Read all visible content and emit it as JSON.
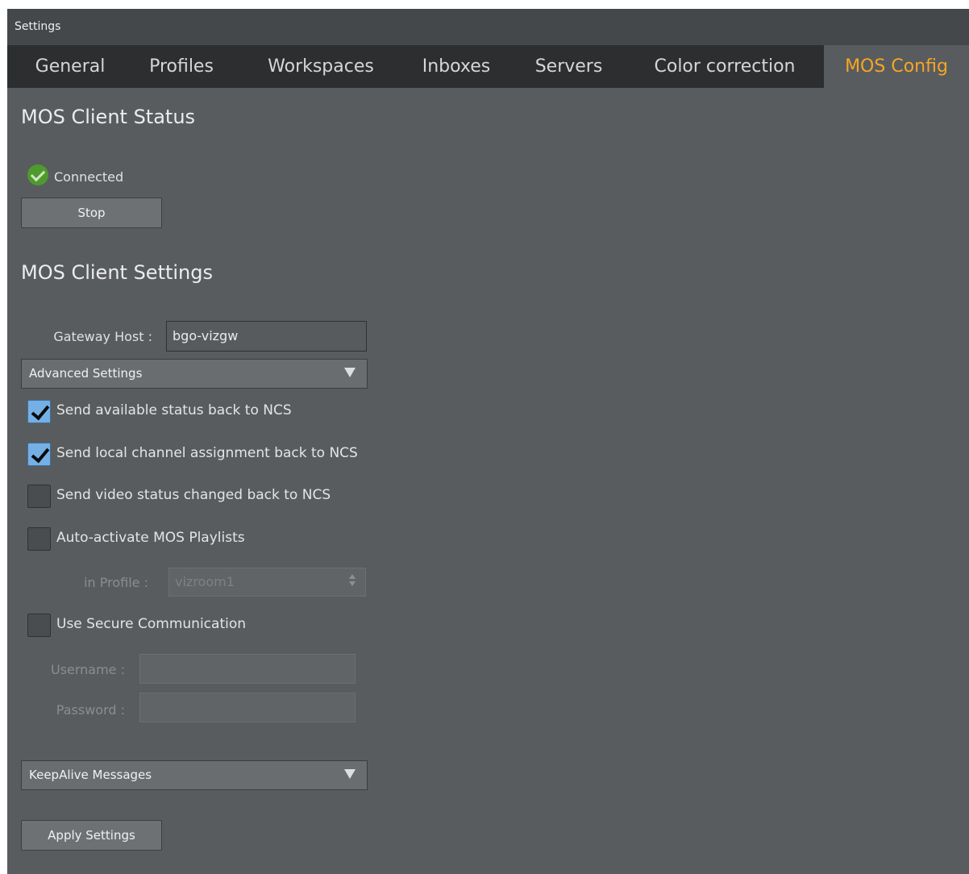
{
  "window": {
    "title": "Settings"
  },
  "tabs": [
    {
      "label": "General"
    },
    {
      "label": "Profiles"
    },
    {
      "label": "Workspaces"
    },
    {
      "label": "Inboxes"
    },
    {
      "label": "Servers"
    },
    {
      "label": "Color correction"
    },
    {
      "label": "MOS Config",
      "active": true
    }
  ],
  "status": {
    "heading": "MOS Client Status",
    "state": "Connected",
    "icon": "check-circle-icon",
    "stop_label": "Stop"
  },
  "settings": {
    "heading": "MOS Client Settings",
    "gateway_label": "Gateway Host :",
    "gateway_value": "bgo-vizgw",
    "advanced_label": "Advanced Settings",
    "options": [
      {
        "label": "Send available status back to NCS",
        "checked": true
      },
      {
        "label": "Send local channel assignment back to NCS",
        "checked": true
      },
      {
        "label": "Send video status changed back to NCS",
        "checked": false
      },
      {
        "label": "Auto-activate MOS Playlists",
        "checked": false
      }
    ],
    "profile_label": "in Profile :",
    "profile_value": "vizroom1",
    "secure_label": "Use Secure Communication",
    "secure_checked": false,
    "username_label": "Username :",
    "password_label": "Password :",
    "keepalive_label": "KeepAlive Messages",
    "apply_label": "Apply Settings"
  },
  "colors": {
    "accent": "#f5a623",
    "background": "#595c5f",
    "tabbar": "#2c2e30",
    "checkbox_checked": "#74b0e6",
    "status_ok": "#4f9a2e"
  }
}
